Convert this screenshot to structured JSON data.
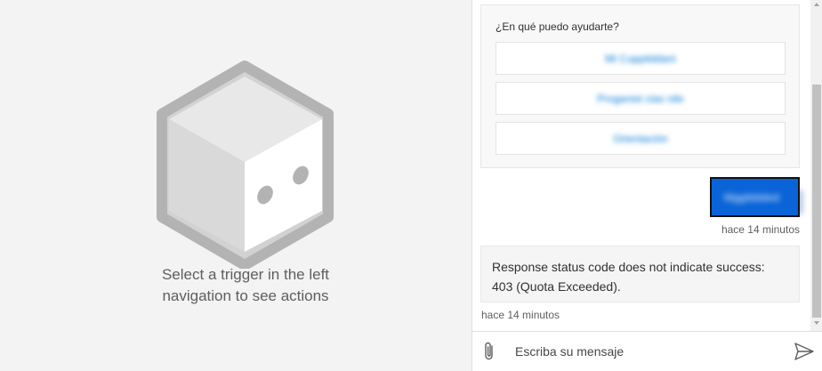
{
  "left_pane": {
    "empty_message": "Select a trigger in the left navigation to see actions"
  },
  "chat": {
    "suggestion_card": {
      "title": "¿En qué puedo ayudarte?",
      "buttons": [
        {
          "label": "Mi Cuppilddani"
        },
        {
          "label": "Proganist cias nile"
        },
        {
          "label": "Orientación"
        }
      ]
    },
    "user_message": {
      "text": "Mggilddded",
      "timestamp": "hace 14 minutos"
    },
    "bot_message": {
      "text": "Response status code does not indicate success: 403 (Quota Exceeded).",
      "timestamp": "hace 14 minutos"
    },
    "composer": {
      "placeholder": "Escriba su mensaje",
      "attach_icon": "paperclip-icon",
      "send_icon": "send-icon"
    }
  },
  "colors": {
    "user_bubble": "#0a64d8",
    "link_text": "#0078d4",
    "background": "#f3f3f3"
  }
}
